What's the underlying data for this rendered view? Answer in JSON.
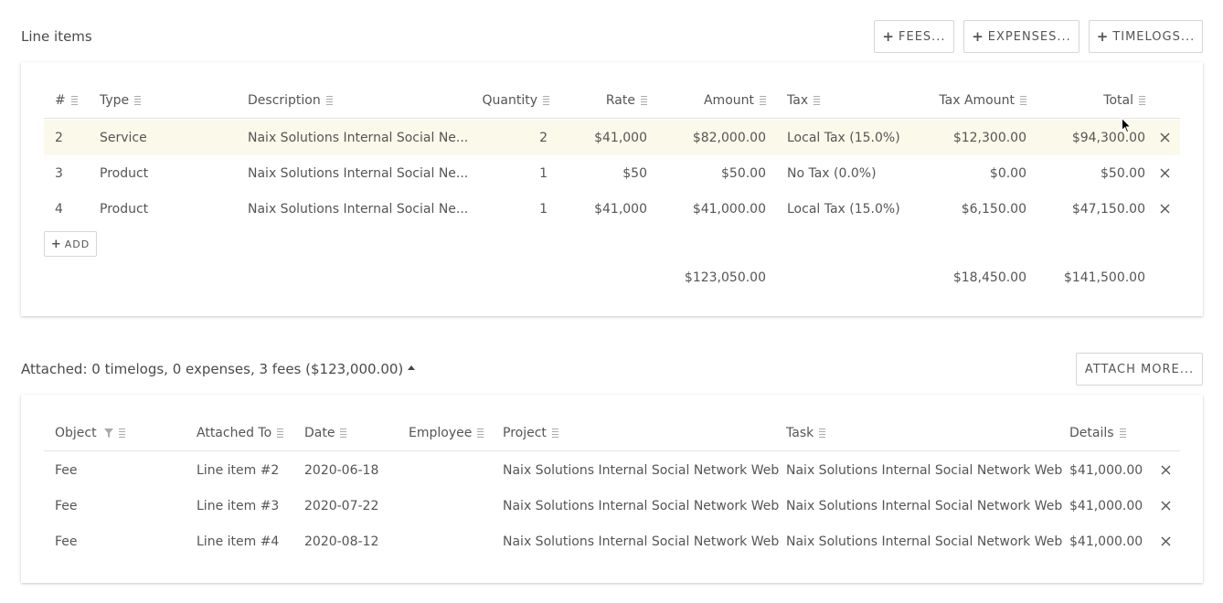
{
  "line_items": {
    "title": "Line items",
    "buttons": {
      "fees": "FEES...",
      "expenses": "EXPENSES...",
      "timelogs": "TIMELOGS..."
    },
    "columns": {
      "num": "#",
      "type": "Type",
      "description": "Description",
      "quantity": "Quantity",
      "rate": "Rate",
      "amount": "Amount",
      "tax": "Tax",
      "tax_amount": "Tax Amount",
      "total": "Total"
    },
    "rows": [
      {
        "num": "2",
        "type": "Service",
        "description": "Naix Solutions Internal Social Ne...",
        "quantity": "2",
        "rate": "$41,000",
        "amount": "$82,000.00",
        "tax": "Local Tax (15.0%)",
        "tax_amount": "$12,300.00",
        "total": "$94,300.00"
      },
      {
        "num": "3",
        "type": "Product",
        "description": "Naix Solutions Internal Social Ne...",
        "quantity": "1",
        "rate": "$50",
        "amount": "$50.00",
        "tax": "No Tax (0.0%)",
        "tax_amount": "$0.00",
        "total": "$50.00"
      },
      {
        "num": "4",
        "type": "Product",
        "description": "Naix Solutions Internal Social Ne...",
        "quantity": "1",
        "rate": "$41,000",
        "amount": "$41,000.00",
        "tax": "Local Tax (15.0%)",
        "tax_amount": "$6,150.00",
        "total": "$47,150.00"
      }
    ],
    "add_label": "ADD",
    "totals": {
      "amount": "$123,050.00",
      "tax_amount": "$18,450.00",
      "total": "$141,500.00"
    }
  },
  "attached": {
    "title": "Attached: 0 timelogs, 0 expenses, 3 fees ($123,000.00)",
    "attach_more": "ATTACH MORE...",
    "columns": {
      "object": "Object",
      "attached_to": "Attached To",
      "date": "Date",
      "employee": "Employee",
      "project": "Project",
      "task": "Task",
      "details": "Details"
    },
    "rows": [
      {
        "object": "Fee",
        "attached_to": "Line item #2",
        "date": "2020-06-18",
        "employee": "",
        "project": "Naix Solutions Internal Social Network Web",
        "task": "Naix Solutions Internal Social Network Web",
        "details": "$41,000.00"
      },
      {
        "object": "Fee",
        "attached_to": "Line item #3",
        "date": "2020-07-22",
        "employee": "",
        "project": "Naix Solutions Internal Social Network Web",
        "task": "Naix Solutions Internal Social Network Web",
        "details": "$41,000.00"
      },
      {
        "object": "Fee",
        "attached_to": "Line item #4",
        "date": "2020-08-12",
        "employee": "",
        "project": "Naix Solutions Internal Social Network Web",
        "task": "Naix Solutions Internal Social Network Web",
        "details": "$41,000.00"
      }
    ]
  },
  "colors": {
    "highlight_row": "#fbf9ea",
    "border": "#d6d6d6",
    "text": "#555555"
  }
}
